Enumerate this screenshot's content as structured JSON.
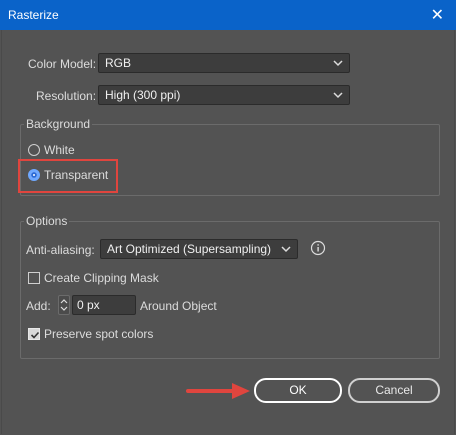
{
  "titlebar": {
    "title": "Rasterize",
    "close_glyph": "✕",
    "bg_color": "#0a63c9"
  },
  "color_model": {
    "label": "Color Model:",
    "value": "RGB"
  },
  "resolution": {
    "label": "Resolution:",
    "value": "High (300 ppi)"
  },
  "background": {
    "title": "Background",
    "options": [
      {
        "label": "White",
        "selected": false
      },
      {
        "label": "Transparent",
        "selected": true
      }
    ],
    "highlight_color": "#e0453e"
  },
  "options": {
    "title": "Options",
    "anti_aliasing": {
      "label": "Anti-aliasing:",
      "value": "Art Optimized (Supersampling)",
      "info_icon": "info-icon"
    },
    "create_clipping_mask": {
      "label": "Create Clipping Mask",
      "checked": false
    },
    "add": {
      "label": "Add:",
      "value": "0 px",
      "suffix": "Around Object"
    },
    "preserve_spot_colors": {
      "label": "Preserve spot colors",
      "checked": true
    }
  },
  "buttons": {
    "ok_label": "OK",
    "cancel_label": "Cancel"
  },
  "annotation": {
    "arrow_color": "#e0453e"
  }
}
